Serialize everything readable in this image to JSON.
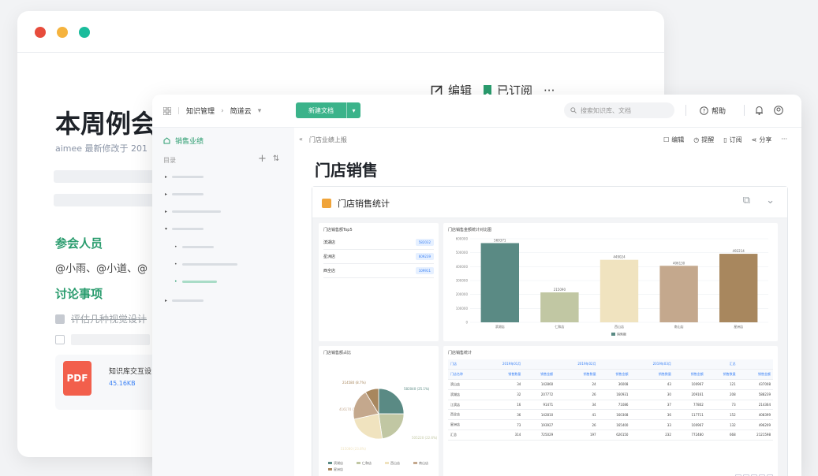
{
  "colors": {
    "red": "#e74c3c",
    "yellow": "#f5b33e",
    "teal": "#1abc9c",
    "green": "#3bb38a",
    "title_green": "#2a9c6e"
  },
  "back": {
    "edit_label": "编辑",
    "subscribed_label": "已订阅",
    "more": "···",
    "title": "本周例会",
    "meta": "aimee 最新修改于 201",
    "attendees_heading": "参会人员",
    "attendees": "@小雨、@小道、@",
    "topics_heading": "讨论事项",
    "todo1": "评估几种视觉设计",
    "file": {
      "badge": "PDF",
      "name": "知识库交互设",
      "size": "45.16KB"
    }
  },
  "front": {
    "breadcrumb": [
      "知识管理",
      "简道云"
    ],
    "new_doc": "新建文档",
    "search_placeholder": "搜索知识库、文档",
    "help": "帮助",
    "sidebar": {
      "title": "销售业绩",
      "dir": "目录",
      "add": "+",
      "sort": "⇅"
    },
    "crumb": "门店业绩上报",
    "back_arrow": "«",
    "actions": {
      "edit": "编辑",
      "remind": "提醒",
      "subscribe": "订阅",
      "share": "分享",
      "more": "···"
    },
    "doc_title": "门店销售",
    "panel_title": "门店销售统计"
  },
  "ranking": {
    "title": "门店销售额Top5",
    "rows": [
      {
        "name": "滨湖店",
        "value": "582032"
      },
      {
        "name": "星洲店",
        "value": "609239"
      },
      {
        "name": "西全店",
        "value": "109911"
      }
    ]
  },
  "chart_data": [
    {
      "type": "bar",
      "title": "门店销售金额统计对比图",
      "categories": [
        "滨湖店",
        "仁和店",
        "西山店",
        "南山店",
        "星洲店"
      ],
      "values": [
        569000,
        215000,
        449000,
        406000,
        492000
      ],
      "ylim": [
        0,
        600000
      ],
      "yticks": [
        0,
        100000,
        200000,
        300000,
        400000,
        500000,
        600000
      ],
      "data_labels": [
        "569371",
        "215090",
        "449024",
        "406130",
        "492214"
      ],
      "legend": [
        "销售额"
      ],
      "series_color": "#5a8a84",
      "colors": [
        "#5a8a84",
        "#c1c7a3",
        "#f0e3bf",
        "#c4a88d",
        "#a8875e"
      ]
    },
    {
      "type": "pie",
      "title": "门店销售额占比",
      "slices": [
        {
          "label": "滨湖店",
          "value": 25.1
        },
        {
          "label": "仁和店",
          "value": 22.6
        },
        {
          "label": "西山店",
          "value": 23.8
        },
        {
          "label": "南山店",
          "value": 19.8
        },
        {
          "label": "星洲店",
          "value": 8.7
        }
      ],
      "callouts": [
        "582040 (25.1%)",
        "505220 (22.6%)",
        "515080 (23.8%)",
        "416170 (19.8%)",
        "214580 (8.7%)"
      ],
      "colors": [
        "#5a8a84",
        "#c1c7a3",
        "#f0e3bf",
        "#c4a88d",
        "#a8875e"
      ]
    }
  ],
  "table": {
    "title": "门店销售统计",
    "head": [
      "门店",
      "2019年01月",
      "",
      "2019年02月",
      "",
      "2019年03月",
      "",
      "汇总",
      ""
    ],
    "subhead": [
      "门店名称",
      "销售数量",
      "销售金额",
      "销售数量",
      "销售金额",
      "销售数量",
      "销售金额",
      "销售数量",
      "销售金额"
    ],
    "rows": [
      [
        "滨山店",
        "34",
        "142860",
        "24",
        "36008",
        "43",
        "100967",
        "121",
        "437008"
      ],
      [
        "滨湖店",
        "32",
        "207772",
        "26",
        "160931",
        "30",
        "209161",
        "208",
        "588239"
      ],
      [
        "江滨店",
        "16",
        "91471",
        "34",
        "71086",
        "37",
        "77802",
        "73",
        "214364"
      ],
      [
        "西全店",
        "36",
        "142810",
        "41",
        "160308",
        "36",
        "117711",
        "152",
        "408399"
      ],
      [
        "星洲店",
        "73",
        "193927",
        "26",
        "165400",
        "33",
        "100967",
        "132",
        "496209"
      ],
      [
        "汇总",
        "314",
        "725029",
        "197",
        "626150",
        "232",
        "772480",
        "668",
        "2121598"
      ]
    ]
  }
}
